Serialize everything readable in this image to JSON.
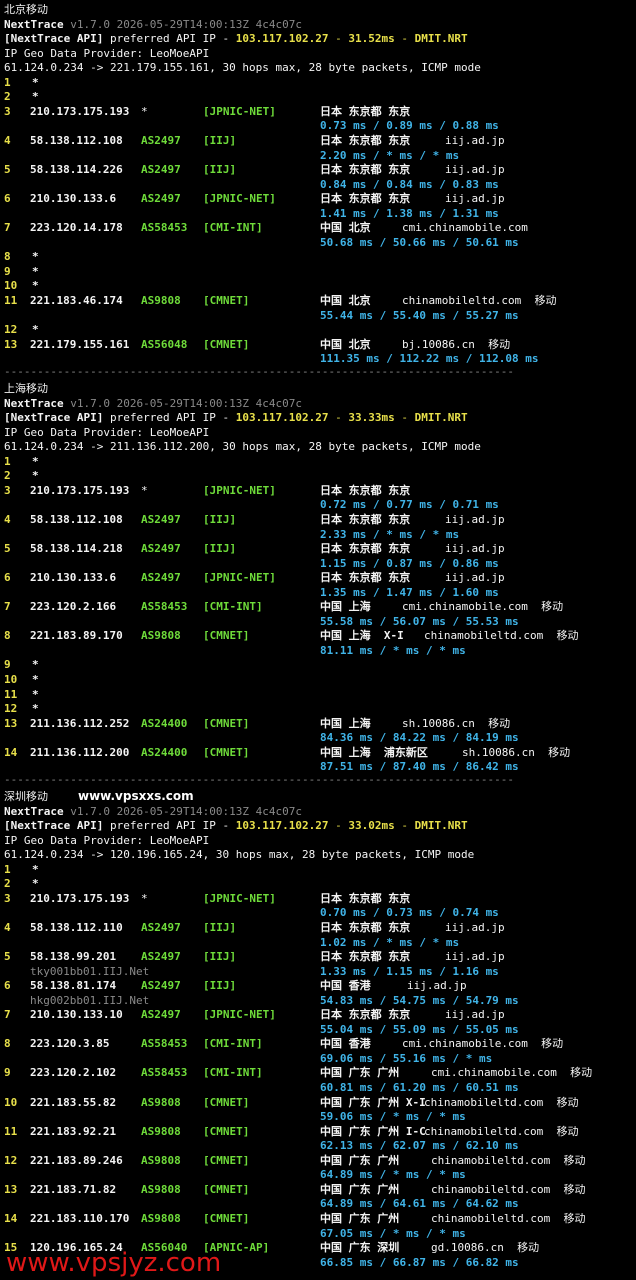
{
  "watermark_site": "www.vpsxxs.com",
  "watermark_bottom": "www.vpsjyz.com",
  "dash_line": "-----------------------------------------------------------------------------",
  "sections": [
    {
      "title": "北京移动",
      "nexttrace": "NextTrace",
      "version": " v1.7.0 2026-05-29T14:00:13Z 4c4c07c",
      "api_prefix": "[NextTrace API]",
      "api_text": " preferred API IP - ",
      "api_ip": "103.117.102.27",
      "api_sep1": " - ",
      "api_ms": "31.52ms",
      "api_sep2": " - ",
      "api_pop": "DMIT.NRT",
      "geo": "IP Geo Data Provider: LeoMoeAPI",
      "cmd": "61.124.0.234 -> 221.179.155.161, 30 hops max, 28 byte packets, ICMP mode",
      "hops": [
        {
          "n": "1",
          "ip": "*"
        },
        {
          "n": "2",
          "ip": "*"
        },
        {
          "n": "3",
          "ip": "210.173.175.193",
          "as": "*",
          "net": "[JPNIC-NET]",
          "loc": "日本 东京都 东京",
          "dom": "",
          "rtt": "0.73 ms / 0.89 ms / 0.88 ms"
        },
        {
          "n": "4",
          "ip": "58.138.112.108",
          "as": "AS2497",
          "net": "[IIJ]",
          "loc": "日本 东京都 东京",
          "dom": "iij.ad.jp",
          "rtt": "2.20 ms / * ms / * ms"
        },
        {
          "n": "5",
          "ip": "58.138.114.226",
          "as": "AS2497",
          "net": "[IIJ]",
          "loc": "日本 东京都 东京",
          "dom": "iij.ad.jp",
          "rtt": "0.84 ms / 0.84 ms / 0.83 ms"
        },
        {
          "n": "6",
          "ip": "210.130.133.6",
          "as": "AS2497",
          "net": "[JPNIC-NET]",
          "loc": "日本 东京都 东京",
          "dom": "iij.ad.jp",
          "rtt": "1.41 ms / 1.38 ms / 1.31 ms"
        },
        {
          "n": "7",
          "ip": "223.120.14.178",
          "as": "AS58453",
          "net": "[CMI-INT]",
          "loc": "中国 北京",
          "dom": "cmi.chinamobile.com",
          "rtt": "50.68 ms / 50.66 ms / 50.61 ms"
        },
        {
          "n": "8",
          "ip": "*"
        },
        {
          "n": "9",
          "ip": "*"
        },
        {
          "n": "10",
          "ip": "*"
        },
        {
          "n": "11",
          "ip": "221.183.46.174",
          "as": "AS9808",
          "net": "[CMNET]",
          "loc": "中国 北京",
          "dom": "chinamobileltd.com  移动",
          "rtt": "55.44 ms / 55.40 ms / 55.27 ms"
        },
        {
          "n": "12",
          "ip": "*"
        },
        {
          "n": "13",
          "ip": "221.179.155.161",
          "as": "AS56048",
          "net": "[CMNET]",
          "loc": "中国 北京",
          "dom": "bj.10086.cn  移动",
          "rtt": "111.35 ms / 112.22 ms / 112.08 ms"
        }
      ]
    },
    {
      "title": "上海移动",
      "nexttrace": "NextTrace",
      "version": " v1.7.0 2026-05-29T14:00:13Z 4c4c07c",
      "api_prefix": "[NextTrace API]",
      "api_text": " preferred API IP - ",
      "api_ip": "103.117.102.27",
      "api_sep1": " - ",
      "api_ms": "33.33ms",
      "api_sep2": " - ",
      "api_pop": "DMIT.NRT",
      "geo": "IP Geo Data Provider: LeoMoeAPI",
      "cmd": "61.124.0.234 -> 211.136.112.200, 30 hops max, 28 byte packets, ICMP mode",
      "hops": [
        {
          "n": "1",
          "ip": "*"
        },
        {
          "n": "2",
          "ip": "*"
        },
        {
          "n": "3",
          "ip": "210.173.175.193",
          "as": "*",
          "net": "[JPNIC-NET]",
          "loc": "日本 东京都 东京",
          "dom": "",
          "rtt": "0.72 ms / 0.77 ms / 0.71 ms"
        },
        {
          "n": "4",
          "ip": "58.138.112.108",
          "as": "AS2497",
          "net": "[IIJ]",
          "loc": "日本 东京都 东京",
          "dom": "iij.ad.jp",
          "rtt": "2.33 ms / * ms / * ms"
        },
        {
          "n": "5",
          "ip": "58.138.114.218",
          "as": "AS2497",
          "net": "[IIJ]",
          "loc": "日本 东京都 东京",
          "dom": "iij.ad.jp",
          "rtt": "1.15 ms / 0.87 ms / 0.86 ms"
        },
        {
          "n": "6",
          "ip": "210.130.133.6",
          "as": "AS2497",
          "net": "[JPNIC-NET]",
          "loc": "日本 东京都 东京",
          "dom": "iij.ad.jp",
          "rtt": "1.35 ms / 1.47 ms / 1.60 ms"
        },
        {
          "n": "7",
          "ip": "223.120.2.166",
          "as": "AS58453",
          "net": "[CMI-INT]",
          "loc": "中国 上海",
          "dom": "cmi.chinamobile.com  移动",
          "rtt": "55.58 ms / 56.07 ms / 55.53 ms"
        },
        {
          "n": "8",
          "ip": "221.183.89.170",
          "as": "AS9808",
          "net": "[CMNET]",
          "loc": "中国 上海  X-I",
          "dom": "chinamobileltd.com  移动",
          "rtt": "81.11 ms / * ms / * ms"
        },
        {
          "n": "9",
          "ip": "*"
        },
        {
          "n": "10",
          "ip": "*"
        },
        {
          "n": "11",
          "ip": "*"
        },
        {
          "n": "12",
          "ip": "*"
        },
        {
          "n": "13",
          "ip": "211.136.112.252",
          "as": "AS24400",
          "net": "[CMNET]",
          "loc": "中国 上海",
          "dom": "sh.10086.cn  移动",
          "rtt": "84.36 ms / 84.22 ms / 84.19 ms"
        },
        {
          "n": "14",
          "ip": "211.136.112.200",
          "as": "AS24400",
          "net": "[CMNET]",
          "loc": "中国 上海  浦东新区",
          "dom": "sh.10086.cn  移动",
          "rtt": "87.51 ms / 87.40 ms / 86.42 ms"
        }
      ]
    },
    {
      "title": "深圳移动",
      "nexttrace": "NextTrace",
      "version": " v1.7.0 2026-05-29T14:00:13Z 4c4c07c",
      "api_prefix": "[NextTrace API]",
      "api_text": " preferred API IP - ",
      "api_ip": "103.117.102.27",
      "api_sep1": " - ",
      "api_ms": "33.02ms",
      "api_sep2": " - ",
      "api_pop": "DMIT.NRT",
      "geo": "IP Geo Data Provider: LeoMoeAPI",
      "cmd": "61.124.0.234 -> 120.196.165.24, 30 hops max, 28 byte packets, ICMP mode",
      "hops": [
        {
          "n": "1",
          "ip": "*"
        },
        {
          "n": "2",
          "ip": "*"
        },
        {
          "n": "3",
          "ip": "210.173.175.193",
          "as": "*",
          "net": "[JPNIC-NET]",
          "loc": "日本 东京都 东京",
          "dom": "",
          "rtt": "0.70 ms / 0.73 ms / 0.74 ms"
        },
        {
          "n": "4",
          "ip": "58.138.112.110",
          "as": "AS2497",
          "net": "[IIJ]",
          "loc": "日本 东京都 东京",
          "dom": "iij.ad.jp",
          "rtt": "1.02 ms / * ms / * ms"
        },
        {
          "n": "5",
          "ip": "58.138.99.201",
          "as": "AS2497",
          "net": "[IIJ]",
          "loc": "日本 东京都 东京",
          "dom": "iij.ad.jp",
          "rtt": "1.33 ms / 1.15 ms / 1.16 ms",
          "host": "tky001bb01.IIJ.Net"
        },
        {
          "n": "6",
          "ip": "58.138.81.174",
          "as": "AS2497",
          "net": "[IIJ]",
          "loc": "中国 香港",
          "dom": "iij.ad.jp",
          "rtt": "54.83 ms / 54.75 ms / 54.79 ms",
          "host": "hkg002bb01.IIJ.Net"
        },
        {
          "n": "7",
          "ip": "210.130.133.10",
          "as": "AS2497",
          "net": "[JPNIC-NET]",
          "loc": "日本 东京都 东京",
          "dom": "iij.ad.jp",
          "rtt": "55.04 ms / 55.09 ms / 55.05 ms"
        },
        {
          "n": "8",
          "ip": "223.120.3.85",
          "as": "AS58453",
          "net": "[CMI-INT]",
          "loc": "中国 香港",
          "dom": "cmi.chinamobile.com  移动",
          "rtt": "69.06 ms / 55.16 ms / * ms"
        },
        {
          "n": "9",
          "ip": "223.120.2.102",
          "as": "AS58453",
          "net": "[CMI-INT]",
          "loc": "中国 广东 广州",
          "dom": "cmi.chinamobile.com  移动",
          "rtt": "60.81 ms / 61.20 ms / 60.51 ms"
        },
        {
          "n": "10",
          "ip": "221.183.55.82",
          "as": "AS9808",
          "net": "[CMNET]",
          "loc": "中国 广东 广州 X-I",
          "dom": "chinamobileltd.com  移动",
          "rtt": "59.06 ms / * ms / * ms"
        },
        {
          "n": "11",
          "ip": "221.183.92.21",
          "as": "AS9808",
          "net": "[CMNET]",
          "loc": "中国 广东 广州 I-C",
          "dom": "chinamobileltd.com  移动",
          "rtt": "62.13 ms / 62.07 ms / 62.10 ms"
        },
        {
          "n": "12",
          "ip": "221.183.89.246",
          "as": "AS9808",
          "net": "[CMNET]",
          "loc": "中国 广东 广州",
          "dom": "chinamobileltd.com  移动",
          "rtt": "64.89 ms / * ms / * ms"
        },
        {
          "n": "13",
          "ip": "221.183.71.82",
          "as": "AS9808",
          "net": "[CMNET]",
          "loc": "中国 广东 广州",
          "dom": "chinamobileltd.com  移动",
          "rtt": "64.89 ms / 64.61 ms / 64.62 ms"
        },
        {
          "n": "14",
          "ip": "221.183.110.170",
          "as": "AS9808",
          "net": "[CMNET]",
          "loc": "中国 广东 广州",
          "dom": "chinamobileltd.com  移动",
          "rtt": "67.05 ms / * ms / * ms"
        },
        {
          "n": "15",
          "ip": "120.196.165.24",
          "as": "AS56040",
          "net": "[APNIC-AP]",
          "loc": "中国 广东 深圳",
          "dom": "gd.10086.cn  移动",
          "rtt": "66.85 ms / 66.87 ms / 66.82 ms"
        }
      ]
    }
  ]
}
